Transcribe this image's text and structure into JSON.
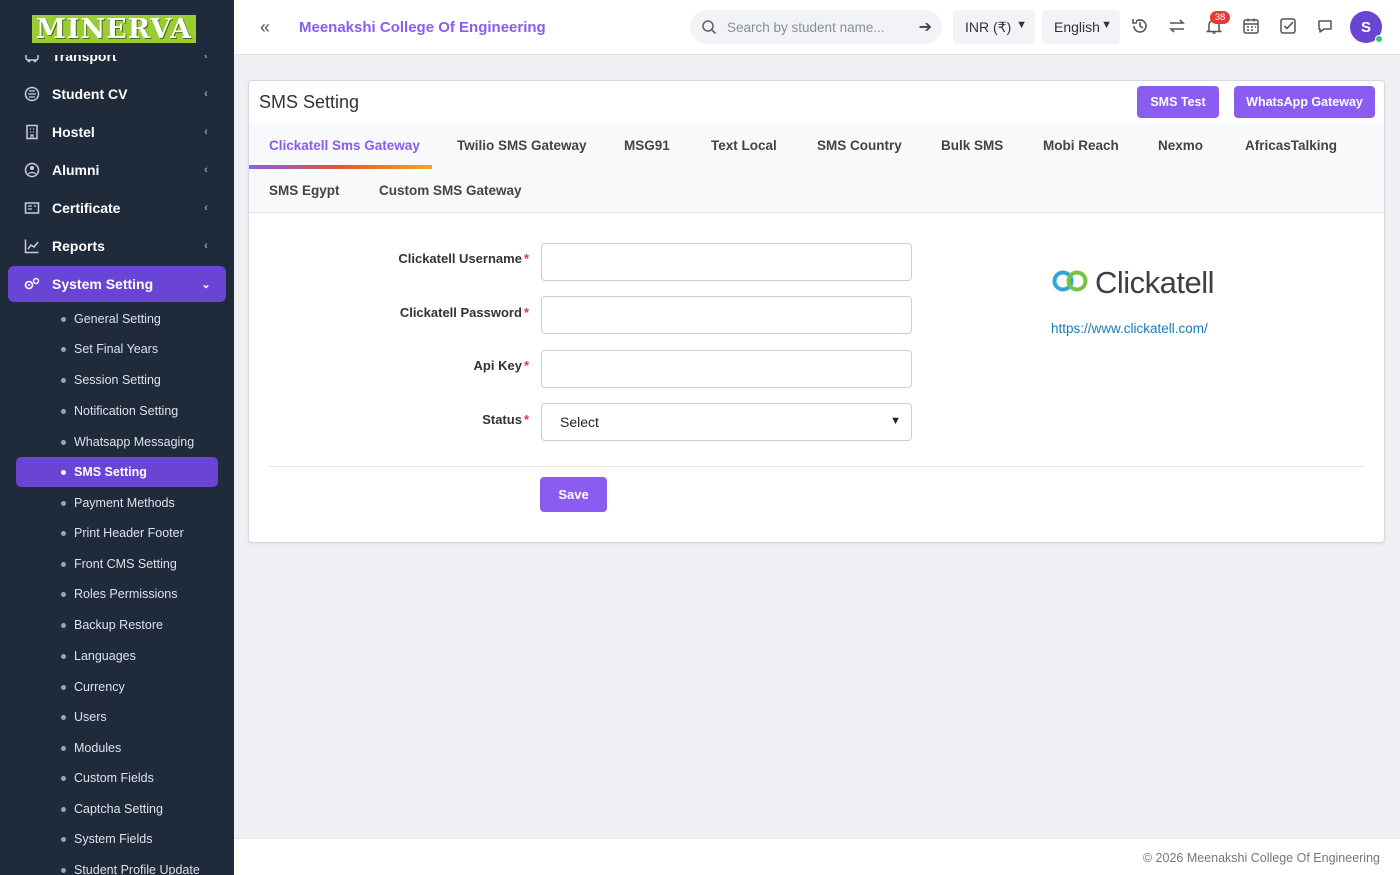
{
  "logo": {
    "text": "MINERVA"
  },
  "sidebar": {
    "menu": [
      {
        "label": "Transport",
        "icon": "bus-icon"
      },
      {
        "label": "Student CV",
        "icon": "cv-icon"
      },
      {
        "label": "Hostel",
        "icon": "building-icon"
      },
      {
        "label": "Alumni",
        "icon": "alumni-icon"
      },
      {
        "label": "Certificate",
        "icon": "certificate-icon"
      },
      {
        "label": "Reports",
        "icon": "chart-line-icon"
      },
      {
        "label": "System Setting",
        "icon": "gears-icon",
        "active": true
      }
    ],
    "submenu": [
      "General Setting",
      "Set Final Years",
      "Session Setting",
      "Notification Setting",
      "Whatsapp Messaging",
      "SMS Setting",
      "Payment Methods",
      "Print Header Footer",
      "Front CMS Setting",
      "Roles Permissions",
      "Backup Restore",
      "Languages",
      "Currency",
      "Users",
      "Modules",
      "Custom Fields",
      "Captcha Setting",
      "System Fields",
      "Student Profile Update"
    ],
    "active_sub": "SMS Setting"
  },
  "header": {
    "school_name": "Meenakshi College Of Engineering",
    "search_placeholder": "Search by student name...",
    "currency": "INR (₹)",
    "language": "English",
    "notification_count": "38",
    "avatar_letter": "S"
  },
  "page": {
    "title": "SMS Setting",
    "buttons": {
      "sms_test": "SMS Test",
      "whatsapp": "WhatsApp Gateway"
    },
    "tabs": [
      "Clickatell Sms Gateway",
      "Twilio SMS Gateway",
      "MSG91",
      "Text Local",
      "SMS Country",
      "Bulk SMS",
      "Mobi Reach",
      "Nexmo",
      "AfricasTalking",
      "SMS Egypt",
      "Custom SMS Gateway"
    ],
    "active_tab": "Clickatell Sms Gateway",
    "form": {
      "username_label": "Clickatell Username",
      "password_label": "Clickatell Password",
      "apikey_label": "Api Key",
      "status_label": "Status",
      "required_mark": "*",
      "status_value": "Select",
      "username_value": "",
      "password_value": "",
      "apikey_value": ""
    },
    "save_label": "Save",
    "provider": {
      "name": "Clickatell",
      "url": "https://www.clickatell.com/"
    }
  },
  "footer": {
    "text": "© 2026 Meenakshi College Of Engineering"
  },
  "colors": {
    "accent": "#8a5cf0",
    "sidebar_bg": "#1f2a3b",
    "active_menu": "#6a44d4",
    "badge": "#e53935"
  }
}
